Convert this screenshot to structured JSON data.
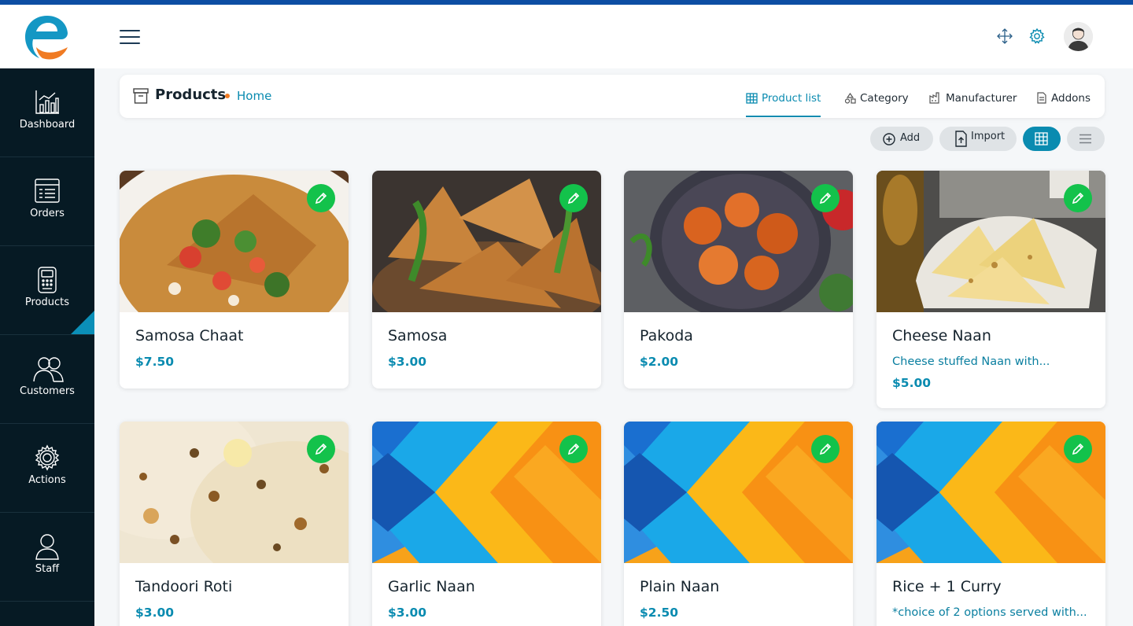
{
  "colors": {
    "accent": "#0a8bb0",
    "edit": "#13c24b",
    "sidebar": "#061a24",
    "brand_blue": "#0d4ea3",
    "brand_orange": "#f07b23"
  },
  "header": {
    "logo_icon": "brand-e-logo",
    "menu_icon": "hamburger-icon",
    "icons": [
      "move-arrows-icon",
      "settings-gear-icon",
      "user-avatar"
    ]
  },
  "sidebar": {
    "items": [
      {
        "label": "Dashboard",
        "icon": "bar-chart-icon"
      },
      {
        "label": "Orders",
        "icon": "list-icon"
      },
      {
        "label": "Products",
        "icon": "calculator-icon",
        "active": true
      },
      {
        "label": "Customers",
        "icon": "users-icon"
      },
      {
        "label": "Actions",
        "icon": "gear-icon"
      },
      {
        "label": "Staff",
        "icon": "person-icon"
      }
    ]
  },
  "pagebar": {
    "title": "Products",
    "breadcrumb_home": "Home",
    "tabs": [
      {
        "label": "Product list",
        "icon": "grid-table-icon",
        "active": true
      },
      {
        "label": "Category",
        "icon": "shapes-icon"
      },
      {
        "label": "Manufacturer",
        "icon": "factory-icon"
      },
      {
        "label": "Addons",
        "icon": "document-icon"
      }
    ]
  },
  "toolbar": {
    "add_label": "Add",
    "import_label": "Import",
    "view_grid": "grid-view-icon",
    "view_list": "list-view-icon"
  },
  "products": [
    {
      "name": "Samosa Chaat",
      "price": "$7.50",
      "description": "",
      "image": "samosa-chaat-photo"
    },
    {
      "name": "Samosa",
      "price": "$3.00",
      "description": "",
      "image": "samosa-photo"
    },
    {
      "name": "Pakoda",
      "price": "$2.00",
      "description": "",
      "image": "pakoda-photo"
    },
    {
      "name": "Cheese Naan",
      "price": "$5.00",
      "description": "Cheese stuffed Naan with...",
      "image": "cheese-naan-photo"
    },
    {
      "name": "Tandoori Roti",
      "price": "$3.00",
      "description": "",
      "image": "tandoori-roti-photo"
    },
    {
      "name": "Garlic Naan",
      "price": "$3.00",
      "description": "",
      "image": "placeholder-chevron"
    },
    {
      "name": "Plain Naan",
      "price": "$2.50",
      "description": "",
      "image": "placeholder-chevron"
    },
    {
      "name": "Rice + 1 Curry",
      "price": "",
      "description": "*choice of 2 options served with...",
      "image": "placeholder-chevron"
    }
  ]
}
